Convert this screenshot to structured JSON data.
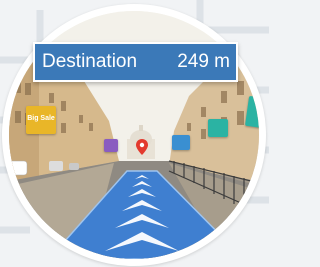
{
  "navigation": {
    "destination_label": "Destination",
    "distance": "249 m"
  },
  "markers": {
    "sale_sign_text": "Big Sale"
  },
  "colors": {
    "banner": "#3b79b8",
    "route": "#3f7fd0",
    "pin": "#e33a2e"
  }
}
